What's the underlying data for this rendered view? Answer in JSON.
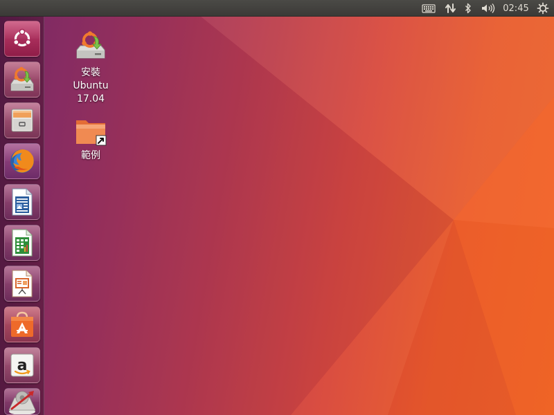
{
  "panel": {
    "clock": "02:45",
    "indicators": [
      "keyboard-icon",
      "network-icon",
      "bluetooth-icon",
      "volume-icon",
      "power-icon"
    ]
  },
  "launcher": {
    "items": [
      {
        "name": "dash-home-icon"
      },
      {
        "name": "install-ubuntu-icon"
      },
      {
        "name": "files-icon"
      },
      {
        "name": "firefox-icon"
      },
      {
        "name": "libreoffice-writer-icon"
      },
      {
        "name": "libreoffice-calc-icon"
      },
      {
        "name": "libreoffice-impress-icon"
      },
      {
        "name": "software-center-icon"
      },
      {
        "name": "amazon-icon"
      },
      {
        "name": "system-settings-icon"
      }
    ]
  },
  "desktop": {
    "icons": [
      {
        "label": "安裝\nUbuntu\n17.04",
        "icon": "install-ubuntu-icon"
      },
      {
        "label": "範例",
        "icon": "folder-link-icon"
      }
    ]
  },
  "colors": {
    "panel": "#3c3b37",
    "wallpaper_left": "#7a2a6a",
    "wallpaper_right": "#ec6227",
    "ubuntu_orange": "#e95420"
  }
}
